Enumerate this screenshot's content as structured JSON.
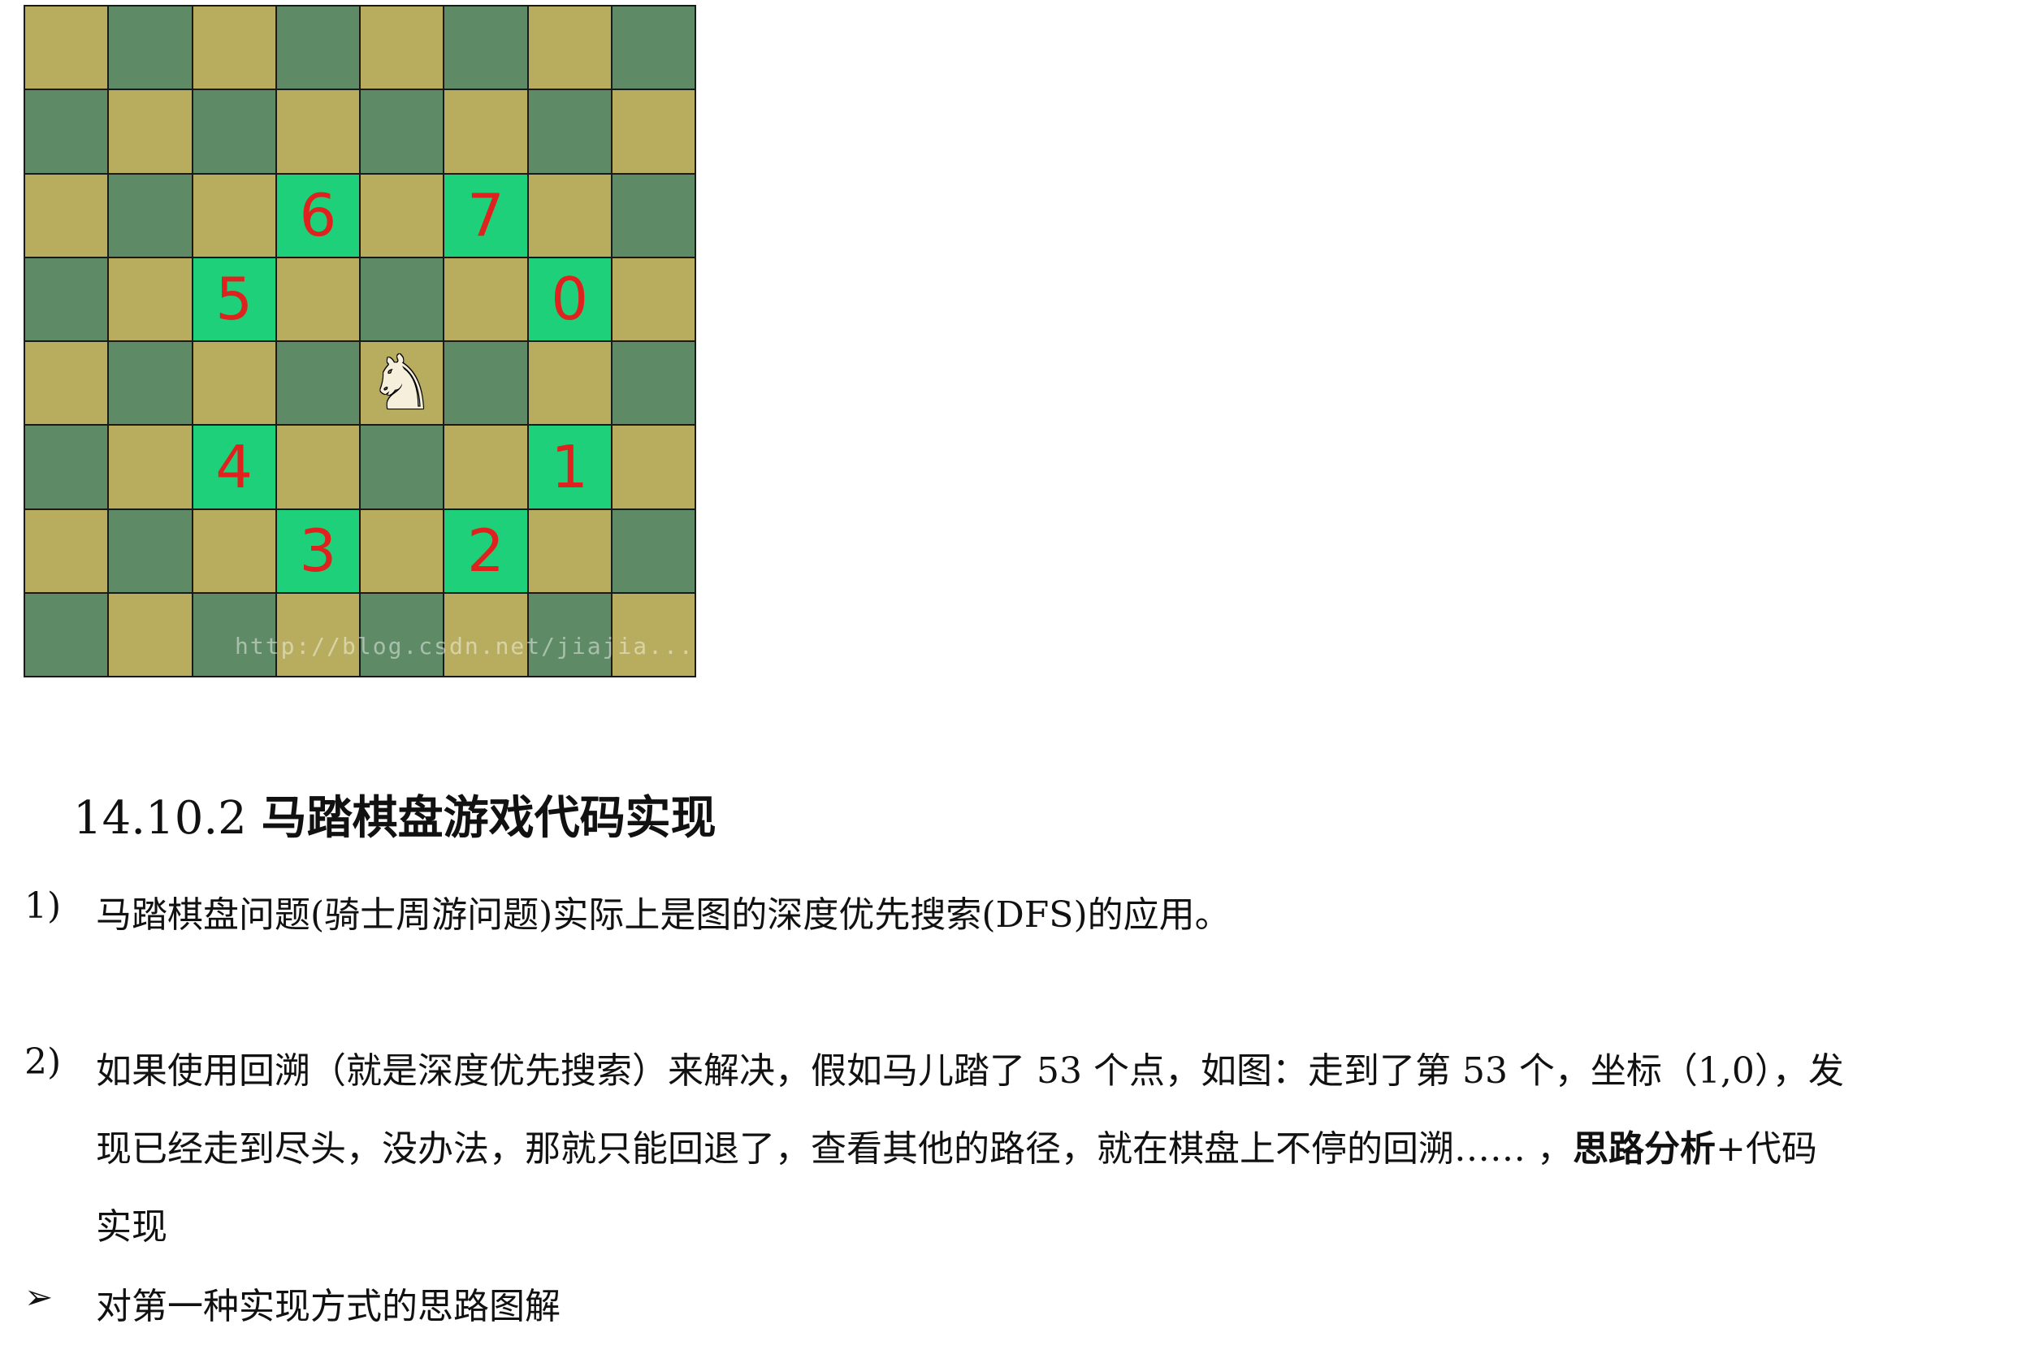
{
  "board": {
    "rows": 8,
    "cols": 8,
    "colors": {
      "light": "#b8ad5f",
      "dark": "#5f8a66",
      "highlight": "#1fd07a",
      "label": "#e0221f"
    },
    "knight": {
      "row": 4,
      "col": 4,
      "icon": "knight-icon",
      "glyph": "♞"
    },
    "moves": [
      {
        "row": 3,
        "col": 6,
        "label": "0"
      },
      {
        "row": 5,
        "col": 6,
        "label": "1"
      },
      {
        "row": 6,
        "col": 5,
        "label": "2"
      },
      {
        "row": 6,
        "col": 3,
        "label": "3"
      },
      {
        "row": 5,
        "col": 2,
        "label": "4"
      },
      {
        "row": 3,
        "col": 2,
        "label": "5"
      },
      {
        "row": 2,
        "col": 3,
        "label": "6"
      },
      {
        "row": 2,
        "col": 5,
        "label": "7"
      }
    ],
    "watermark": "http://blog.csdn.net/jiajia..."
  },
  "section": {
    "number": "14.10.2",
    "title": "马踏棋盘游戏代码实现"
  },
  "items": [
    {
      "marker": "1)",
      "text": "马踏棋盘问题(骑士周游问题)实际上是图的深度优先搜索(DFS)的应用。"
    },
    {
      "marker": "2)",
      "line1": "如果使用回溯（就是深度优先搜索）来解决，假如马儿踏了 53 个点，如图：走到了第 53 个，坐标（1,0），发",
      "line2_a": "现已经走到尽头，没办法，那就只能回退了，查看其他的路径，就在棋盘上不停的回溯…… ，",
      "line2_bold": "思路分析",
      "line2_b": "+代码",
      "line3": "实现"
    },
    {
      "marker": "➢",
      "text": "对第一种实现方式的思路图解"
    }
  ]
}
